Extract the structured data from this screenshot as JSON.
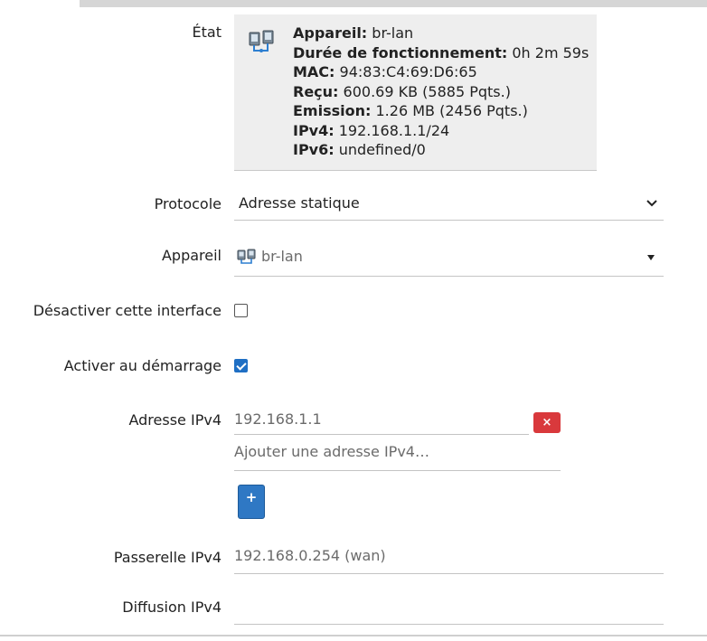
{
  "status": {
    "label": "État",
    "device_key": "Appareil:",
    "device_val": "br-lan",
    "uptime_key": "Durée de fonctionnement:",
    "uptime_val": "0h 2m 59s",
    "mac_key": "MAC:",
    "mac_val": "94:83:C4:69:D6:65",
    "rx_key": "Reçu:",
    "rx_val": "600.69 KB (5885 Pqts.)",
    "tx_key": "Emission:",
    "tx_val": "1.26 MB (2456 Pqts.)",
    "ipv4_key": "IPv4:",
    "ipv4_val": "192.168.1.1/24",
    "ipv6_key": "IPv6:",
    "ipv6_val": "undefined/0"
  },
  "protocol": {
    "label": "Protocole",
    "value": "Adresse statique"
  },
  "device": {
    "label": "Appareil",
    "value": "br-lan"
  },
  "disable_iface": {
    "label": "Désactiver cette interface",
    "checked": false
  },
  "boot_enable": {
    "label": "Activer au démarrage",
    "checked": true
  },
  "ipv4_address": {
    "label": "Adresse IPv4",
    "value": "192.168.1.1",
    "remove_glyph": "×",
    "placeholder": "Ajouter une adresse IPv4…",
    "add_glyph": "+"
  },
  "ipv4_gateway": {
    "label": "Passerelle IPv4",
    "placeholder": "192.168.0.254 (wan)"
  },
  "ipv4_broadcast": {
    "label": "Diffusion IPv4",
    "value": ""
  },
  "colors": {
    "remove": "#d9393c",
    "add": "#2f78c4",
    "check": "#1f6fc4"
  }
}
